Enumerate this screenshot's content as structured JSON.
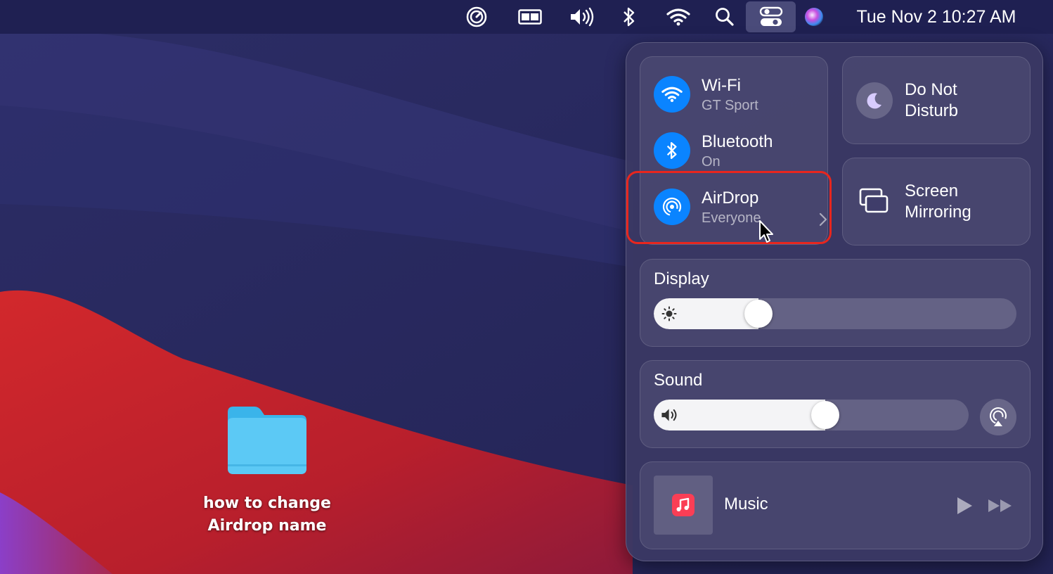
{
  "menubar": {
    "icons": [
      "screen-time-icon",
      "display-mirror-icon",
      "volume-icon",
      "bluetooth-icon",
      "wifi-icon",
      "spotlight-search-icon",
      "control-center-icon",
      "siri-icon"
    ],
    "clock": "Tue Nov 2  10:27 AM"
  },
  "desktop": {
    "folder_label_line1": "how to change",
    "folder_label_line2": "Airdrop name"
  },
  "control_center": {
    "wifi": {
      "title": "Wi-Fi",
      "subtitle": "GT Sport"
    },
    "bluetooth": {
      "title": "Bluetooth",
      "subtitle": "On"
    },
    "airdrop": {
      "title": "AirDrop",
      "subtitle": "Everyone"
    },
    "do_not_disturb": {
      "line1": "Do Not",
      "line2": "Disturb"
    },
    "screen_mirroring": {
      "line1": "Screen",
      "line2": "Mirroring"
    },
    "display": {
      "title": "Display",
      "brightness": 0.27
    },
    "sound": {
      "title": "Sound",
      "volume": 0.55
    },
    "music": {
      "title": "Music"
    }
  },
  "colors": {
    "accent_blue": "#0a84ff",
    "highlight_red": "#e8261e",
    "music_icon_red": "#fa3e55"
  }
}
